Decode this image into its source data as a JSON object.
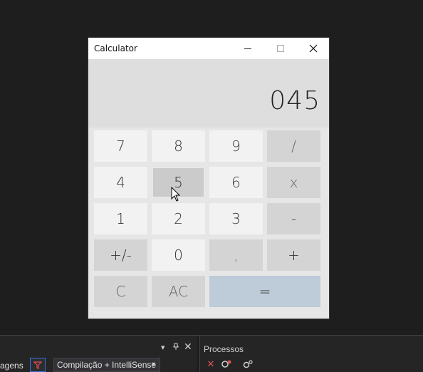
{
  "window": {
    "title": "Calculator",
    "minimize_icon": "minimize-icon",
    "maximize_icon": "maximize-icon",
    "close_icon": "close-icon"
  },
  "display": {
    "value": "045"
  },
  "keys": {
    "k7": "7",
    "k8": "8",
    "k9": "9",
    "div": "/",
    "k4": "4",
    "k5": "5",
    "k6": "6",
    "mul": "x",
    "k1": "1",
    "k2": "2",
    "k3": "3",
    "sub": "-",
    "neg": "+/-",
    "k0": "0",
    "dec": ",",
    "add": "+",
    "clear": "C",
    "all_clear": "AC",
    "equals": "="
  },
  "ide": {
    "left_panel": {
      "text": "agens",
      "dropdown_value": "Compilação + IntelliSense"
    },
    "right_panel": {
      "title": "Processos"
    }
  },
  "colors": {
    "equals_bg": "#becbd8",
    "ide_bg": "#1e1e1e",
    "accent": "#3a6ed8",
    "delete_red": "#e05252"
  }
}
